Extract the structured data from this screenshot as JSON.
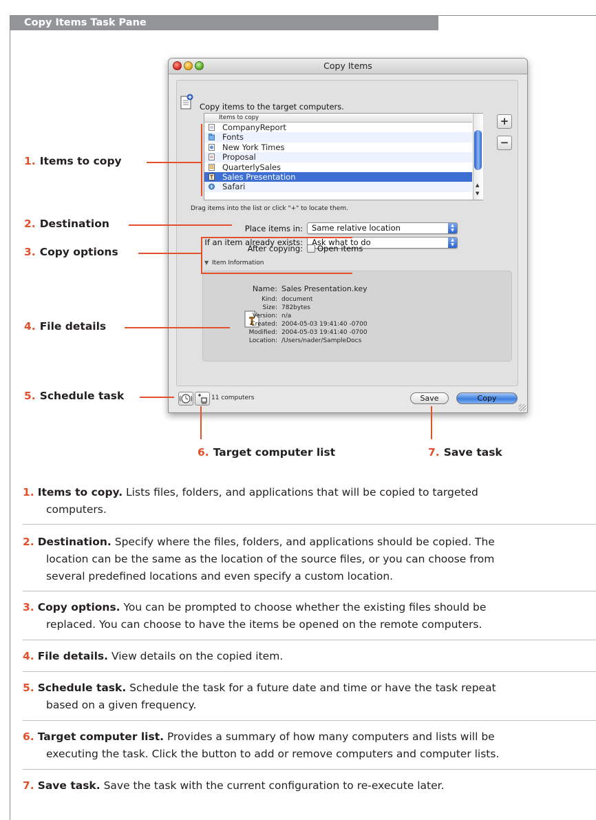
{
  "header": {
    "title": "Copy Items Task Pane"
  },
  "window": {
    "title": "Copy Items",
    "prompt": "Copy items to the target computers.",
    "list_header": "Items to copy",
    "items": [
      {
        "label": "CompanyReport",
        "icon": "document-icon"
      },
      {
        "label": "Fonts",
        "icon": "folder-icon"
      },
      {
        "label": "New York Times",
        "icon": "web-document-icon"
      },
      {
        "label": "Proposal",
        "icon": "document-icon"
      },
      {
        "label": "QuarterlySales",
        "icon": "spreadsheet-icon"
      },
      {
        "label": "Sales Presentation",
        "icon": "keynote-icon",
        "selected": true
      },
      {
        "label": "Safari",
        "icon": "compass-icon"
      }
    ],
    "add_label": "+",
    "remove_label": "−",
    "drag_hint": "Drag items into the list or click \"+\" to locate them.",
    "place_label": "Place items in:",
    "place_value": "Same relative location",
    "exists_label": "If an item already exists:",
    "exists_value": "Ask what to do",
    "after_label": "After copying:",
    "open_items_label": "Open items",
    "open_items_checked": false,
    "info_disclosure": "Item Information",
    "info": {
      "name_label": "Name:",
      "name": "Sales Presentation.key",
      "kind_label": "Kind:",
      "kind": "document",
      "size_label": "Size:",
      "size": "782bytes",
      "version_label": "Version:",
      "version": "n/a",
      "created_label": "Created:",
      "created": "2004-05-03 19:41:40 -0700",
      "modified_label": "Modified:",
      "modified": "2004-05-03 19:41:40 -0700",
      "location_label": "Location:",
      "location": "/Users/nader/SampleDocs"
    },
    "computers": "11 computers",
    "save_button": "Save",
    "copy_button": "Copy"
  },
  "callouts": {
    "c1": {
      "num": "1.",
      "label": "Items to copy"
    },
    "c2": {
      "num": "2.",
      "label": "Destination"
    },
    "c3": {
      "num": "3.",
      "label": "Copy options"
    },
    "c4": {
      "num": "4.",
      "label": "File details"
    },
    "c5": {
      "num": "5.",
      "label": "Schedule task"
    },
    "c6": {
      "num": "6.",
      "label": "Target computer list"
    },
    "c7": {
      "num": "7.",
      "label": "Save task"
    }
  },
  "descriptions": [
    {
      "num": "1.",
      "title": "Items to copy.",
      "first": "Lists files, folders, and applications that will be copied to targeted",
      "rest": [
        "computers."
      ]
    },
    {
      "num": "2.",
      "title": "Destination.",
      "first": "Specify where the files, folders, and applications should be copied. The",
      "rest": [
        "location can be the same as the location of the source files, or you can choose from",
        "several predefined locations and even specify a custom location."
      ]
    },
    {
      "num": "3.",
      "title": "Copy options.",
      "first": "You can be prompted to choose whether the existing files should be",
      "rest": [
        "replaced. You can choose to have the items be opened on the remote computers."
      ]
    },
    {
      "num": "4.",
      "title": "File details.",
      "first": "View details on the copied item.",
      "rest": []
    },
    {
      "num": "5.",
      "title": "Schedule task.",
      "first": "Schedule the task for a future date and time or have the task repeat",
      "rest": [
        "based on a given frequency."
      ]
    },
    {
      "num": "6.",
      "title": "Target computer list.",
      "first": "Provides a summary of how many computers and lists will be",
      "rest": [
        "executing the task. Click the button to add or remove computers and computer lists."
      ]
    },
    {
      "num": "7.",
      "title": "Save task.",
      "first": "Save the task with the current configuration to re-execute later.",
      "rest": []
    }
  ],
  "colors": {
    "accent": "#e2512c",
    "header_bg": "#939598",
    "selection": "#3d6fd3"
  }
}
